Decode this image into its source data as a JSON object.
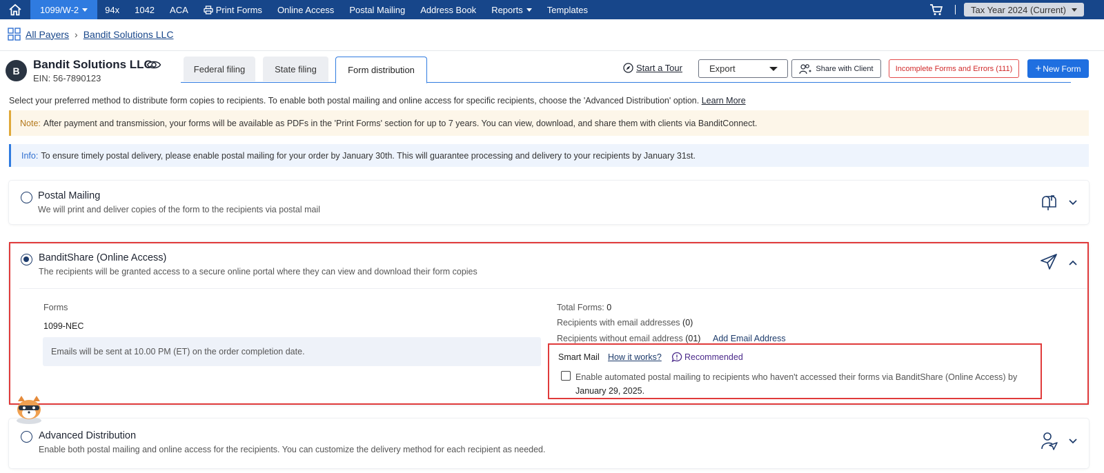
{
  "nav": {
    "items": [
      "1099/W-2",
      "94x",
      "1042",
      "ACA",
      "Print Forms",
      "Online Access",
      "Postal Mailing",
      "Address Book",
      "Reports",
      "Templates"
    ],
    "tax_year": "Tax Year 2024 (Current)"
  },
  "breadcrumb": {
    "root": "All Payers",
    "current": "Bandit Solutions LLC"
  },
  "payer": {
    "initial": "B",
    "name": "Bandit Solutions LLC",
    "ein": "EIN: 56-7890123"
  },
  "tabs": [
    "Federal filing",
    "State filing",
    "Form distribution"
  ],
  "toolbar": {
    "tour": "Start a Tour",
    "export": "Export",
    "share": "Share with Client",
    "errors": "Incomplete Forms and Errors (111)",
    "new_form": "New Form"
  },
  "intro": {
    "text": "Select your preferred method to distribute form copies to recipients. To enable both postal mailing and online access for specific recipients, choose the 'Advanced Distribution' option.",
    "link": "Learn More"
  },
  "note": {
    "label": "Note:",
    "text": "After payment and transmission, your forms will be available as PDFs in the 'Print Forms' section for up to 7 years. You can view, download, and share them with clients via BanditConnect."
  },
  "info": {
    "label": "Info:",
    "text": "To ensure timely postal delivery, please enable postal mailing for your order by January 30th. This will guarantee processing and delivery to your recipients by January 31st."
  },
  "options": {
    "postal": {
      "title": "Postal Mailing",
      "subtitle": "We will print and deliver copies of the form to the recipients via postal mail"
    },
    "online": {
      "title": "BanditShare (Online Access)",
      "subtitle": "The recipients will be granted access to a secure online portal where they can view and download their form copies"
    },
    "advanced": {
      "title": "Advanced Distribution",
      "subtitle": "Enable both postal mailing and online access for the recipients. You can customize the delivery method for each recipient as needed."
    }
  },
  "online_details": {
    "forms_label": "Forms",
    "form_type": "1099-NEC",
    "email_note": "Emails will be sent at 10.00 PM (ET) on the order completion date.",
    "total_forms_label": "Total Forms:",
    "total_forms": "0",
    "with_email_label": "Recipients with email addresses",
    "with_email": "(0)",
    "without_email_label": "Recipients without email address",
    "without_email": "(01)",
    "add_email": "Add Email Address"
  },
  "smart_mail": {
    "title": "Smart Mail",
    "how": "How it works?",
    "recommended": "Recommended",
    "text": "Enable automated postal mailing to recipients who haven't accessed their forms via BanditShare (Online Access) by",
    "date": "January 29, 2025."
  }
}
